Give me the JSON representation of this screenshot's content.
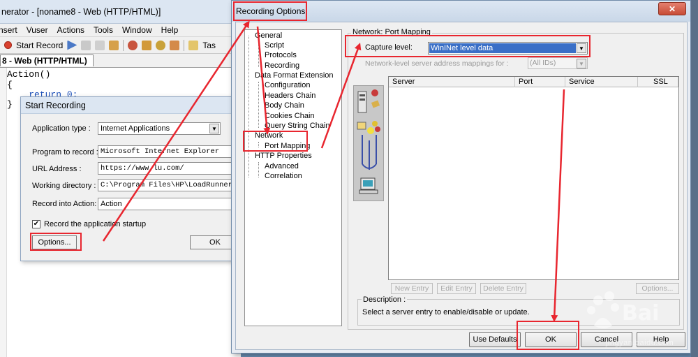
{
  "background_window": {
    "title": "nerator - [noname8 - Web (HTTP/HTML)]",
    "menu": [
      "nsert",
      "Vuser",
      "Actions",
      "Tools",
      "Window",
      "Help"
    ],
    "toolbar": {
      "start_record_label": "Start Record",
      "task_label": "Tas"
    },
    "tab_label": "8 - Web (HTTP/HTML)",
    "code": [
      "Action()",
      "{",
      "    return 0;",
      "}"
    ]
  },
  "start_recording": {
    "title": "Start Recording",
    "application_type_label": "Application type :",
    "application_type_value": "Internet Applications",
    "program_label": "Program to record :",
    "program_value": "Microsoft Internet Explorer",
    "url_label": "URL Address :",
    "url_value": "https://www.lu.com/",
    "working_dir_label": "Working directory :",
    "working_dir_value": "C:\\Program Files\\HP\\LoadRunner\\bin\\",
    "record_into_label": "Record into Action:",
    "record_into_value": "Action",
    "startup_checkbox_label": "Record the application startup",
    "startup_checked": "✔",
    "options_button": "Options...",
    "ok_button": "OK"
  },
  "recording_options": {
    "title": "Recording Options",
    "close_glyph": "✕",
    "tree": {
      "general": "General",
      "script": "Script",
      "protocols": "Protocols",
      "recording": "Recording",
      "data_format_extension": "Data Format Extension",
      "configuration": "Configuration",
      "headers_chain": "Headers Chain",
      "body_chain": "Body Chain",
      "cookies_chain": "Cookies Chain",
      "query_string_chain": "Query String Chain",
      "network": "Network",
      "port_mapping": "Port Mapping",
      "http_properties": "HTTP Properties",
      "advanced": "Advanced",
      "correlation": "Correlation"
    },
    "group_title": "Network: Port Mapping",
    "capture_level_label": "Capture level:",
    "capture_level_value": "WinINet level data",
    "network_mapping_label": "Network-level server address mappings for :",
    "network_mapping_value": "(All IDs)",
    "table_headers": [
      "Server",
      "Port",
      "Service",
      "SSL"
    ],
    "buttons": {
      "new_entry": "New Entry",
      "edit_entry": "Edit Entry",
      "delete_entry": "Delete Entry",
      "options": "Options..."
    },
    "description_label": "Description :",
    "description_text": "Select a server entry to enable/disable or update.",
    "bottom_buttons": {
      "use_defaults": "Use Defaults",
      "ok": "OK",
      "cancel": "Cancel",
      "help": "Help"
    }
  },
  "watermark": {
    "text": "jingyan.baidu.com"
  },
  "colors": {
    "highlight": "#e8262f",
    "selection": "#3a6fc7"
  }
}
